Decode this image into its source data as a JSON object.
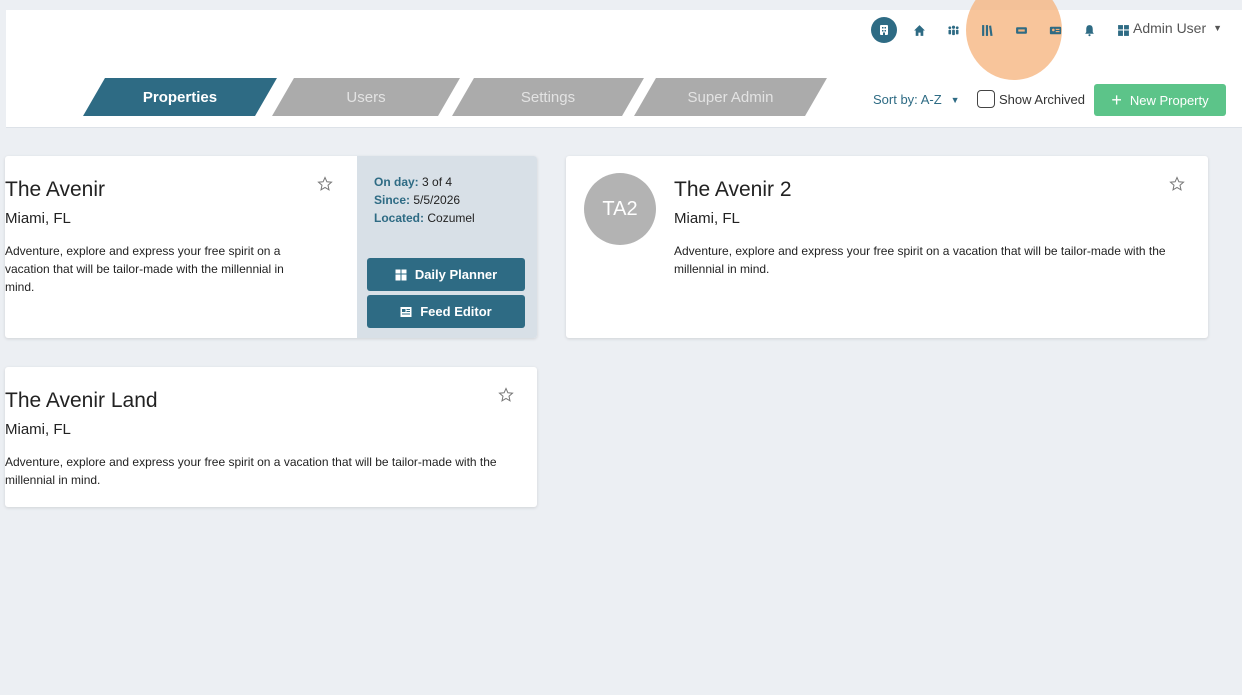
{
  "header": {
    "user_name": "Admin User",
    "icons": [
      "hotel-icon",
      "home-icon",
      "group-icon",
      "library-icon",
      "ticket-icon",
      "id-card-icon",
      "bell-icon",
      "dashboard-icon"
    ]
  },
  "tabs": [
    {
      "label": "Properties",
      "active": true
    },
    {
      "label": "Users",
      "active": false
    },
    {
      "label": "Settings",
      "active": false
    },
    {
      "label": "Super Admin",
      "active": false
    }
  ],
  "toolbar": {
    "sort_label": "Sort by: A-Z",
    "show_archived_label": "Show Archived",
    "show_archived_checked": false,
    "new_property_label": "New Property"
  },
  "properties": [
    {
      "name": "The Avenir",
      "location": "Miami, FL",
      "description": "Adventure, explore and express your free spirit on a vacation that will be tailor-made with the millennial in mind.",
      "on_day_label": "On day:",
      "on_day_value": "3 of 4",
      "since_label": "Since:",
      "since_value": "5/5/2026",
      "located_label": "Located:",
      "located_value": "Cozumel",
      "daily_planner_label": "Daily Planner",
      "feed_editor_label": "Feed Editor"
    },
    {
      "name": "The Avenir 2",
      "location": "Miami, FL",
      "avatar_initials": "TA2",
      "description": "Adventure, explore and express your free spirit on a vacation that will be tailor-made with the millennial in mind."
    },
    {
      "name": "The Avenir Land",
      "location": "Miami, FL",
      "description": "Adventure, explore and express your free spirit on a vacation that will be tailor-made with the millennial in mind."
    }
  ],
  "colors": {
    "primary": "#2e6b84",
    "success": "#5cc489",
    "tab_inactive": "#ababab",
    "background": "#eceff3"
  }
}
